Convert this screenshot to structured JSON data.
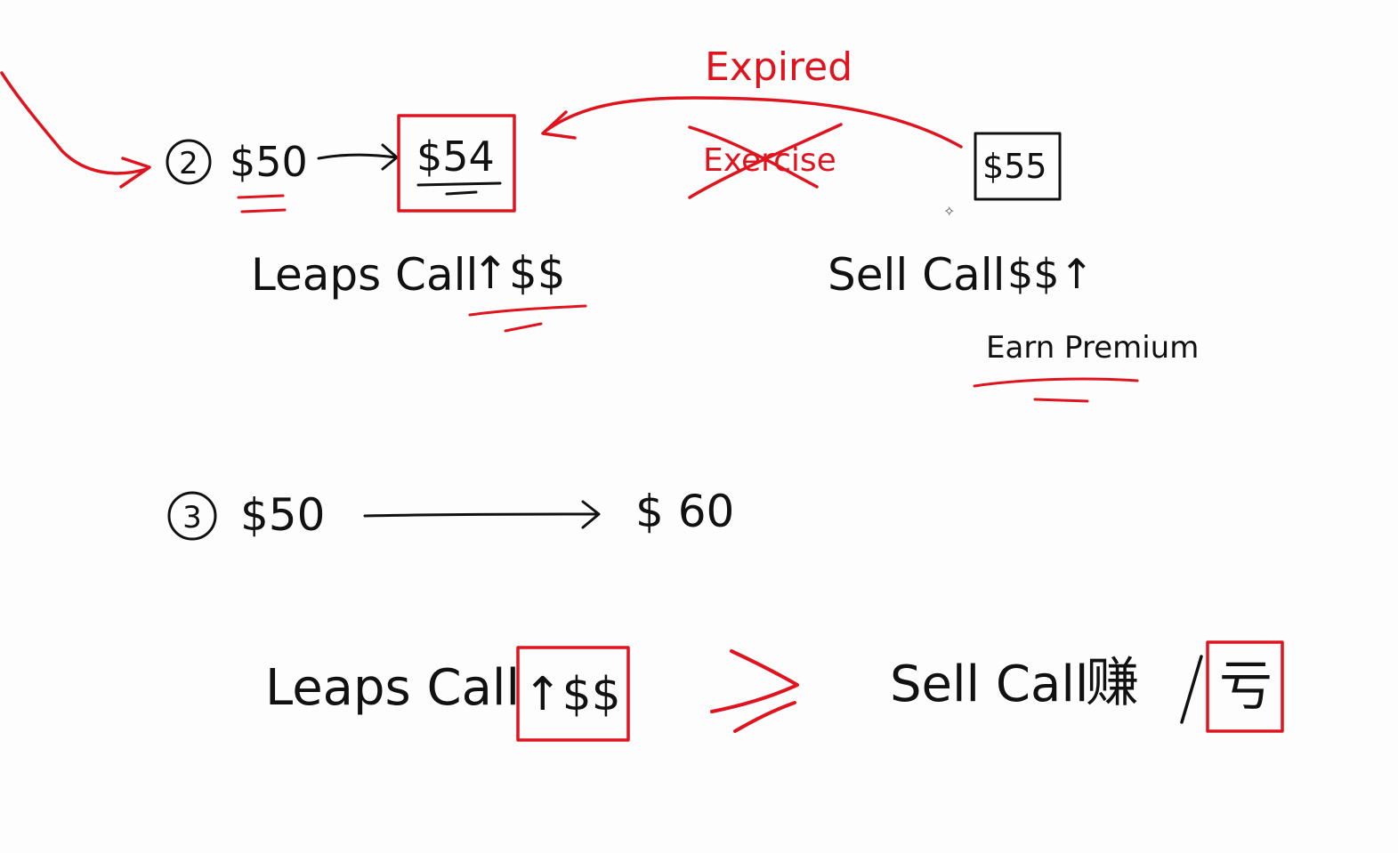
{
  "colors": {
    "black_ink": "#111111",
    "red_ink": "#e0141e",
    "background": "#fdfdfd"
  },
  "scenario2": {
    "number": "2",
    "start_price": "$50",
    "target_price": "$54",
    "strike_price": "$55",
    "arrow_label_expired": "Expired",
    "arrow_label_exercise": "Exercise",
    "leaps_call_label": "Leaps Call",
    "leaps_call_gain": "↑$$",
    "sell_call_label": "Sell Call",
    "sell_call_gain": "$$↑",
    "earn_premium": "Earn Premium"
  },
  "scenario3": {
    "number": "3",
    "start_price": "$50",
    "end_price": "$ 60",
    "leaps_call_label": "Leaps Call",
    "leaps_call_gain": "↑$$",
    "comparison": ">",
    "sell_call_label": "Sell Call",
    "sell_call_earn": "赚",
    "separator": "/",
    "sell_call_loss": "亏"
  },
  "cursor_icon": "sparkle-cursor-icon"
}
